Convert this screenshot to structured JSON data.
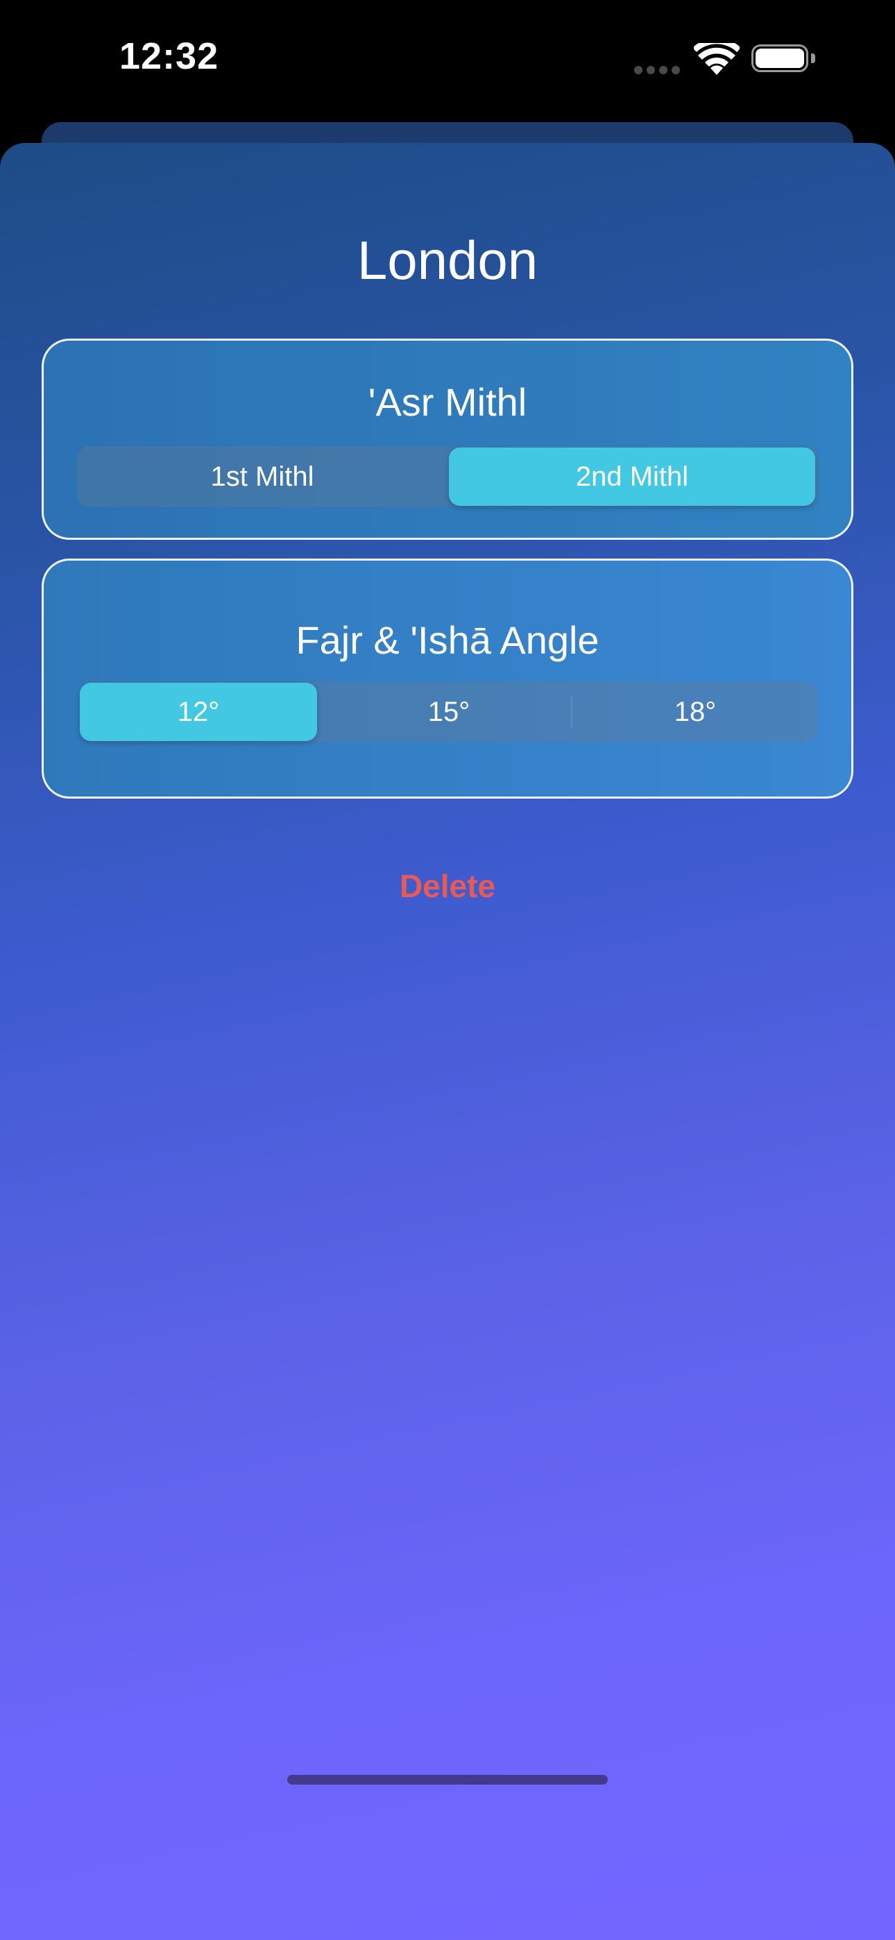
{
  "status_bar": {
    "time": "12:32"
  },
  "page": {
    "title": "London"
  },
  "asr_card": {
    "title": "'Asr Mithl",
    "options": [
      "1st Mithl",
      "2nd Mithl"
    ],
    "selected": "2nd Mithl"
  },
  "fajr_card": {
    "title": "Fajr & 'Ishā Angle",
    "options": [
      "12°",
      "15°",
      "18°"
    ],
    "selected": "12°"
  },
  "actions": {
    "delete_label": "Delete"
  },
  "colors": {
    "accent_selected": "#42c8e3",
    "delete": "#e85a55",
    "gradient_top": "#1d4c86",
    "gradient_bottom": "#7265ff"
  }
}
